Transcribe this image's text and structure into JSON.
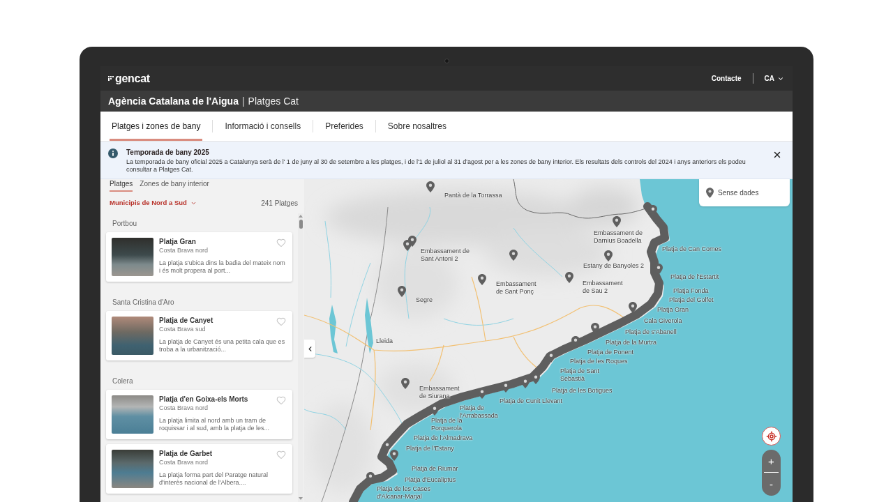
{
  "header": {
    "logo": "gencat",
    "links": [
      {
        "label": "Contacte"
      }
    ],
    "language": "CA"
  },
  "site_title": {
    "agency": "Agència Catalana de l'Aigua",
    "separator": "|",
    "app": "Platges Cat"
  },
  "nav_tabs": [
    {
      "label": "Platges i zones de bany",
      "selected": true
    },
    {
      "label": "Informació i consells",
      "selected": false
    },
    {
      "label": "Preferides",
      "selected": false
    },
    {
      "label": "Sobre nosaltres",
      "selected": false
    }
  ],
  "notice": {
    "title": "Temporada de bany 2025",
    "text": "La temporada de bany oficial 2025 a Catalunya serà de l' 1 de juny al 30 de setembre a les platges, i de l'1 de juliol al 31 d'agost per a les zones de bany interior. Els resultats dels controls del 2024 i anys anteriors els podeu consultar a Platges Cat."
  },
  "sidebar": {
    "tabs": [
      {
        "label": "Platges",
        "selected": true
      },
      {
        "label": "Zones de bany interior",
        "selected": false
      }
    ],
    "sort": "Municipis de Nord a Sud",
    "count": "241 Platges",
    "groups": [
      {
        "municipality": "Portbou",
        "beaches": [
          {
            "name": "Platja Gran",
            "zone": "Costa Brava nord",
            "description": "La platja s'ubica dins la badia del mateix nom i és molt propera al port...",
            "favorite": false
          }
        ]
      },
      {
        "municipality": "Santa Cristina d'Aro",
        "beaches": [
          {
            "name": "Platja de Canyet",
            "zone": "Costa Brava sud",
            "description": "La platja de Canyet és una petita cala que es troba a la urbanització...",
            "favorite": false
          }
        ]
      },
      {
        "municipality": "Colera",
        "beaches": [
          {
            "name": "Platja d'en Goixa-els Morts",
            "zone": "Costa Brava nord",
            "description": "La platja limita al nord amb un tram de roquissar i al sud, amb la platja de les...",
            "favorite": false
          },
          {
            "name": "Platja de Garbet",
            "zone": "Costa Brava nord",
            "description": "La platja forma part del Paratge natural d'interès nacional de l'Albera....",
            "favorite": false
          }
        ]
      }
    ]
  },
  "map": {
    "legend": [
      {
        "label": "Sense dades"
      }
    ],
    "labels": [
      {
        "text": "Pantà de la Torrassa"
      },
      {
        "text": "Embassament de Darnius Boadella"
      },
      {
        "text": "Embassament de Sant Antoni 2"
      },
      {
        "text": "Platja de Can Comes"
      },
      {
        "text": "Estany de Banyoles 2"
      },
      {
        "text": "Platja de l'Estartit"
      },
      {
        "text": "Embassament de Sant Ponç"
      },
      {
        "text": "Embassament de Sau 2"
      },
      {
        "text": "Platja Fonda"
      },
      {
        "text": "Segre"
      },
      {
        "text": "Platja del Golfet"
      },
      {
        "text": "Platja Gran"
      },
      {
        "text": "Cala Giverola"
      },
      {
        "text": "Platja de s'Abanell"
      },
      {
        "text": "Lleida"
      },
      {
        "text": "Platja de la Murtra"
      },
      {
        "text": "Platja de Ponent"
      },
      {
        "text": "Platja de les Roques"
      },
      {
        "text": "Platja de Sant Sebastià"
      },
      {
        "text": "Embassament de Siurana"
      },
      {
        "text": "Platja de les Botigues"
      },
      {
        "text": "Platja de Cunit Llevant"
      },
      {
        "text": "Platja de l'Arrabassada"
      },
      {
        "text": "Platja de la Porquerola"
      },
      {
        "text": "Platja de l'Almadrava"
      },
      {
        "text": "Platja de l'Estany"
      },
      {
        "text": "Platja de Riumar"
      },
      {
        "text": "Platja d'Eucaliptus"
      },
      {
        "text": "Platja de les Cases d'Alcanar-Marjal"
      }
    ],
    "zoom_in": "+",
    "zoom_out": "-"
  }
}
